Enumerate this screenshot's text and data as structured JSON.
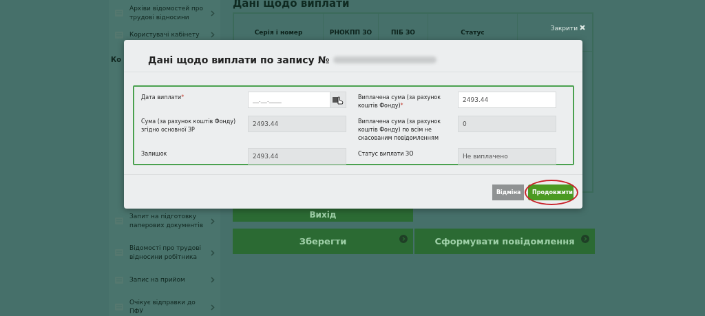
{
  "sidebar": {
    "items": [
      {
        "label": "Архіви відомостей про трудові відносини"
      },
      {
        "label": "Користувачі кабінету"
      }
    ],
    "section_heading": "Ко",
    "lower_items": [
      {
        "label": "Запит на підготовку паперових документів"
      },
      {
        "label": "Відомості про трудові відносини робітника"
      },
      {
        "label": "Запис на прийом"
      },
      {
        "label": "Очікує відправки до ПФУ"
      }
    ]
  },
  "main": {
    "title": "Дані щодо виплати",
    "table": {
      "columns": [
        "Серія і номер",
        "РНОКПП ЗО",
        "ПІБ ЗО",
        "Статус"
      ],
      "close_label": "Закрити"
    },
    "exit_button": "Вихід",
    "buttons": [
      {
        "label": "Зберегти"
      },
      {
        "label": "Сформувати повідомлення"
      }
    ]
  },
  "dialog": {
    "title": "Дані щодо виплати по запису №",
    "required_mark": "*",
    "fields": [
      {
        "label": "Дата виплати",
        "required": true,
        "kind": "date",
        "placeholder": "__.__.____",
        "disabled": false
      },
      {
        "label": "Виплачена сума (за рахунок коштів Фонду)",
        "required": true,
        "kind": "text",
        "value": "2493.44",
        "disabled": false
      },
      {
        "label": "Сума (за рахунок коштів Фонду) згідно основної ЗР",
        "required": false,
        "kind": "text",
        "value": "2493.44",
        "disabled": true
      },
      {
        "label": "Виплачена сума (за рахунок коштів Фонду) по всім не скасованим повідомленням",
        "required": false,
        "kind": "text",
        "value": "0",
        "disabled": true
      },
      {
        "label": "Залишок",
        "required": false,
        "kind": "text",
        "value": "2493.44",
        "disabled": true
      },
      {
        "label": "Статус виплати ЗО",
        "required": false,
        "kind": "text",
        "value": "Не виплачено",
        "disabled": true
      }
    ],
    "buttons": [
      {
        "label": "Відміна",
        "kind": "secondary",
        "highlighted": false
      },
      {
        "label": "Продовжити",
        "kind": "primary",
        "highlighted": true
      }
    ]
  }
}
